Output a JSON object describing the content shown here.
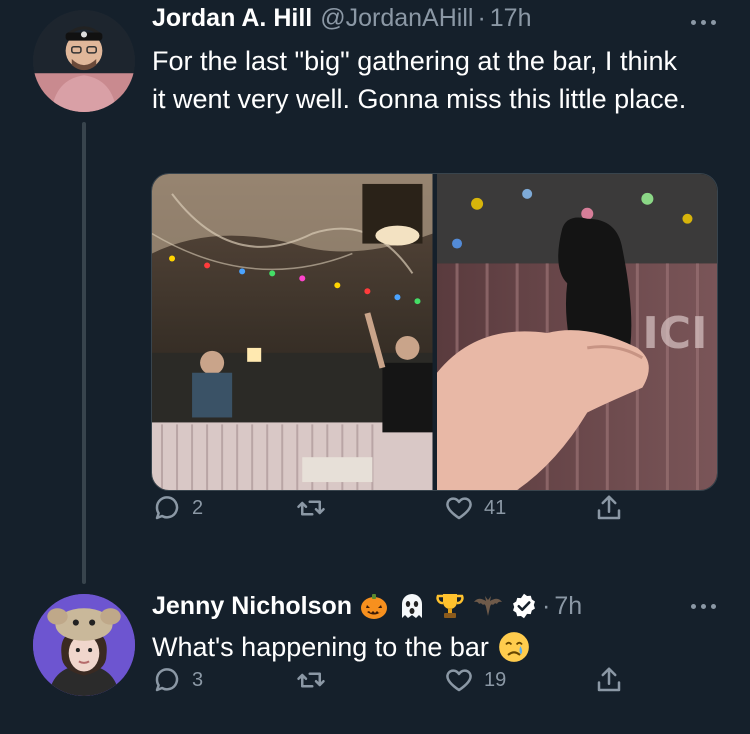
{
  "tweets": [
    {
      "author_name": "Jordan A. Hill",
      "handle": "@JordanAHill",
      "separator": "·",
      "time": "17h",
      "text": "For the last \"big\" gathering at the bar, I think it went very well. Gonna miss this little place.",
      "media": [
        "bar-interior-photo",
        "hand-holding-figurine-photo"
      ],
      "reply_count": "2",
      "retweet_count": "",
      "like_count": "41"
    },
    {
      "author_name": "Jenny Nicholson",
      "handle": "",
      "separator": "·",
      "time": "7h",
      "name_emojis": [
        "jack-o-lantern-icon",
        "ghost-icon",
        "trophy-icon",
        "bat-icon"
      ],
      "verified": true,
      "text": "What's happening to the bar",
      "text_emoji": "crying-face-icon",
      "reply_count": "3",
      "retweet_count": "",
      "like_count": "19"
    }
  ],
  "colors": {
    "background": "#15202b",
    "secondary_text": "#8b98a5",
    "thread_line": "#38444d"
  }
}
